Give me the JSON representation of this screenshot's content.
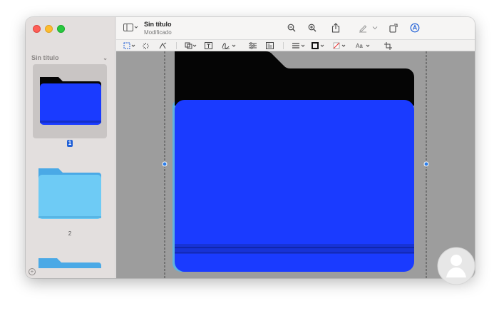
{
  "window": {
    "doc_title": "Sin título",
    "doc_status": "Modificado"
  },
  "sidebar": {
    "title": "Sin título",
    "pages": [
      {
        "number": "1",
        "selected": true,
        "folder_color": "#1a3bff"
      },
      {
        "number": "2",
        "selected": false,
        "folder_color": "#6ecbf5"
      }
    ]
  },
  "toolbar": {
    "icons": [
      "sidebar-toggle-icon",
      "zoom-out-icon",
      "zoom-in-icon",
      "share-icon",
      "highlight-icon",
      "rotate-icon",
      "markup-icon"
    ]
  },
  "markup": {
    "text_style_label": "Aa"
  },
  "colors": {
    "folder_front": "#1a3bff",
    "folder_back": "#050505",
    "folder_light": "#6ecbf5",
    "canvas_bg": "#9d9d9d",
    "accent": "#2160d6"
  }
}
